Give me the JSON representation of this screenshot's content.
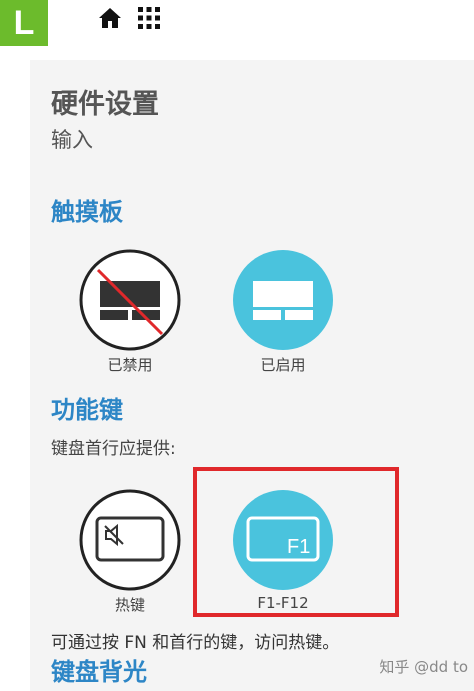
{
  "header": {
    "logo_text": "L",
    "home_icon": "home-icon",
    "apps_icon": "apps-grid-icon"
  },
  "panel": {
    "title": "硬件设置",
    "subtitle": "输入",
    "touchpad": {
      "heading": "触摸板",
      "options": [
        {
          "label": "已禁用",
          "icon": "touchpad-disabled-icon",
          "selected": false
        },
        {
          "label": "已启用",
          "icon": "touchpad-icon",
          "selected": true
        }
      ]
    },
    "function_keys": {
      "heading": "功能键",
      "prompt": "键盘首行应提供:",
      "options": [
        {
          "label": "热键",
          "icon": "hotkey-mute-icon",
          "selected": false
        },
        {
          "label": "F1-F12",
          "icon": "f1-key-icon",
          "key_text": "F1",
          "selected": true
        }
      ],
      "note": "可通过按 FN 和首行的键，访问热键。"
    },
    "backlight": {
      "heading": "键盘背光"
    }
  },
  "watermark": "知乎 @dd to",
  "colors": {
    "accent_green": "#6cbb2c",
    "heading_blue": "#2d86c6",
    "selected_cyan": "#4ac3dd",
    "highlight_red": "#e0282b"
  }
}
